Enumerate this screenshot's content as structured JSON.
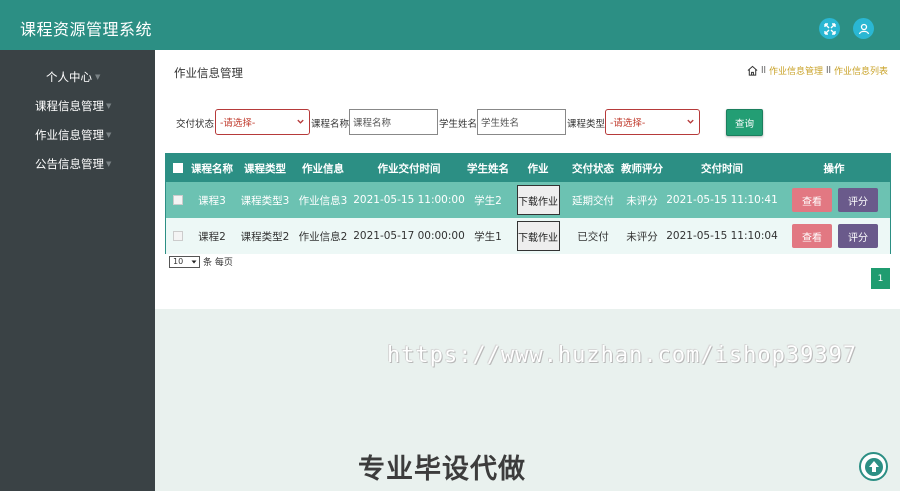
{
  "app": {
    "title": "课程资源管理系统"
  },
  "sidebar": {
    "items": [
      {
        "label": "个人中心"
      },
      {
        "label": "课程信息管理"
      },
      {
        "label": "作业信息管理"
      },
      {
        "label": "公告信息管理"
      }
    ]
  },
  "page": {
    "title": "作业信息管理",
    "breadcrumb": [
      "作业信息管理",
      "作业信息列表"
    ]
  },
  "filters": {
    "submit_status_label": "交付状态",
    "submit_status_value": "-请选择-",
    "course_name_label": "课程名称",
    "course_name_placeholder": "课程名称",
    "student_name_label": "学生姓名",
    "student_name_placeholder": "学生姓名",
    "course_type_label": "课程类型",
    "course_type_value": "-请选择-",
    "query_label": "查询"
  },
  "table": {
    "headers": [
      "课程名称",
      "课程类型",
      "作业信息",
      "作业交付时间",
      "学生姓名",
      "作业",
      "交付状态",
      "教师评分",
      "交付时间",
      "操作"
    ],
    "rows": [
      {
        "course": "课程3",
        "type": "课程类型3",
        "info": "作业信息3",
        "deadline": "2021-05-15 11:00:00",
        "student": "学生2",
        "download": "下载作业",
        "status": "延期交付",
        "score": "未评分",
        "submitted": "2021-05-15 11:10:41",
        "view": "查看",
        "rate": "评分"
      },
      {
        "course": "课程2",
        "type": "课程类型2",
        "info": "作业信息2",
        "deadline": "2021-05-17 00:00:00",
        "student": "学生1",
        "download": "下载作业",
        "status": "已交付",
        "score": "未评分",
        "submitted": "2021-05-15 11:10:04",
        "view": "查看",
        "rate": "评分"
      }
    ]
  },
  "pagination": {
    "page_size": "10",
    "per_page_label": "条 每页",
    "current_page": "1"
  },
  "overlay": {
    "watermark": "https://www.huzhan.com/ishop39397",
    "promo": "专业毕设代做"
  },
  "colors": {
    "header": "#2c8f84",
    "sidebar": "#3a4245",
    "view_button": "#e27882",
    "rate_button": "#6a5a8b",
    "query_button": "#239e74"
  },
  "icons": {
    "fullscreen": "fullscreen-icon",
    "user": "user-icon",
    "home": "home-icon",
    "scroll_top": "arrow-up-icon"
  }
}
